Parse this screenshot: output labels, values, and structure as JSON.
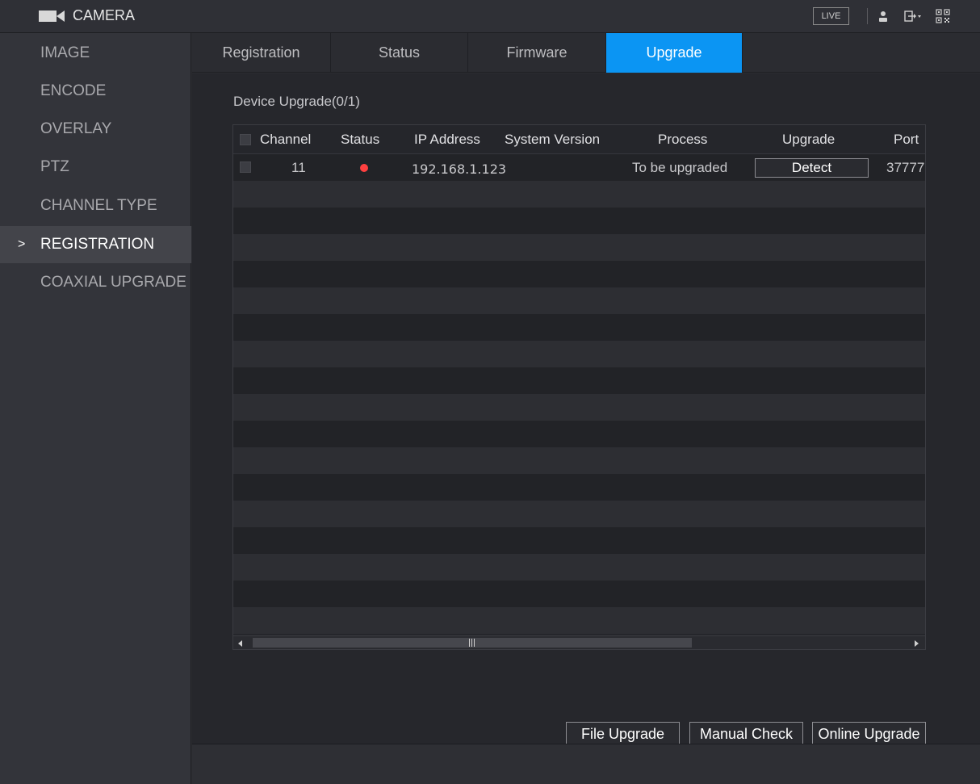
{
  "header": {
    "title": "CAMERA",
    "live_label": "LIVE",
    "icons": [
      "camera-icon",
      "user-icon",
      "logout-icon",
      "qr-code-icon"
    ]
  },
  "sidebar": {
    "items": [
      {
        "label": "IMAGE",
        "active": false
      },
      {
        "label": "ENCODE",
        "active": false
      },
      {
        "label": "OVERLAY",
        "active": false
      },
      {
        "label": "PTZ",
        "active": false
      },
      {
        "label": "CHANNEL TYPE",
        "active": false
      },
      {
        "label": "REGISTRATION",
        "active": true
      },
      {
        "label": "COAXIAL UPGRADE",
        "active": false
      }
    ],
    "active_marker": ">"
  },
  "tabs": [
    {
      "label": "Registration",
      "active": false
    },
    {
      "label": "Status",
      "active": false
    },
    {
      "label": "Firmware",
      "active": false
    },
    {
      "label": "Upgrade",
      "active": true
    }
  ],
  "upgrade": {
    "section_title": "Device Upgrade(0/1)",
    "columns": [
      "Channel",
      "Status",
      "IP Address",
      "System Version",
      "Process",
      "Upgrade",
      "Port"
    ],
    "rows": [
      {
        "channel": "11",
        "status_color": "#ff4040",
        "ip_address": "192.168.1.123",
        "system_version": "",
        "process": "To be upgraded",
        "upgrade_button": "Detect",
        "port": "37777"
      }
    ],
    "buttons": {
      "file_upgrade": "File Upgrade",
      "manual_check": "Manual Check",
      "online_upgrade": "Online Upgrade"
    }
  },
  "colors": {
    "accent": "#0b95f3",
    "status_offline": "#ff4040"
  }
}
